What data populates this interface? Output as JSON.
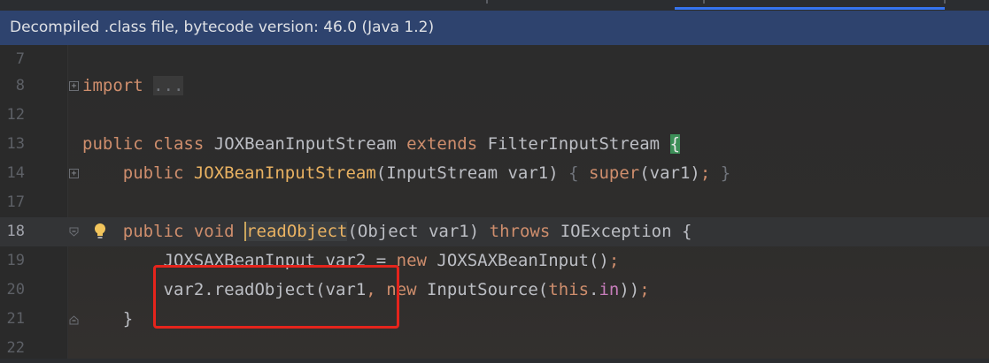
{
  "banner": {
    "text": "Decompiled .class file, bytecode version: 46.0 (Java 1.2)"
  },
  "editor": {
    "lines": [
      {
        "num": "7"
      },
      {
        "num": "8"
      },
      {
        "num": "12"
      },
      {
        "num": "13"
      },
      {
        "num": "14"
      },
      {
        "num": "17"
      },
      {
        "num": "18"
      },
      {
        "num": "19"
      },
      {
        "num": "20"
      },
      {
        "num": "21"
      },
      {
        "num": "22"
      }
    ],
    "code": {
      "import_kw": "import",
      "import_ellipsis": "...",
      "public1": "public",
      "class_kw": "class",
      "class_name": "JOXBeanInputStream",
      "extends_kw": "extends",
      "superclass": "FilterInputStream",
      "open_brace": "{",
      "public2": "public",
      "ctor_name": "JOXBeanInputStream",
      "ctor_params": "(InputStream var1)",
      "ctor_open": "{",
      "super_kw": "super",
      "super_args": "(var1)",
      "semicolon": ";",
      "ctor_close": "}",
      "public3": "public",
      "void_kw": "void",
      "method_name": "readObject",
      "method_params": "(Object var1)",
      "throws_kw": "throws",
      "exception": "IOException {",
      "line19_type": "JOXSAXBeanInput var2 = ",
      "new_kw1": "new",
      "line19_rest": " JOXSAXBeanInput()",
      "line19_semi": ";",
      "line20_call": "var2.readObject(var1",
      "comma": ",",
      "new_kw2": "new",
      "line20_type": " InputSource(",
      "this_kw": "this",
      "dot": ".",
      "in_field": "in",
      "line20_end": "))",
      "line20_semi": ";",
      "close_method": "}"
    }
  },
  "colors": {
    "banner_bg": "#2e436e",
    "keyword": "#cf8e6d",
    "function": "#e9b262",
    "highlight_box": "#e5241c"
  }
}
